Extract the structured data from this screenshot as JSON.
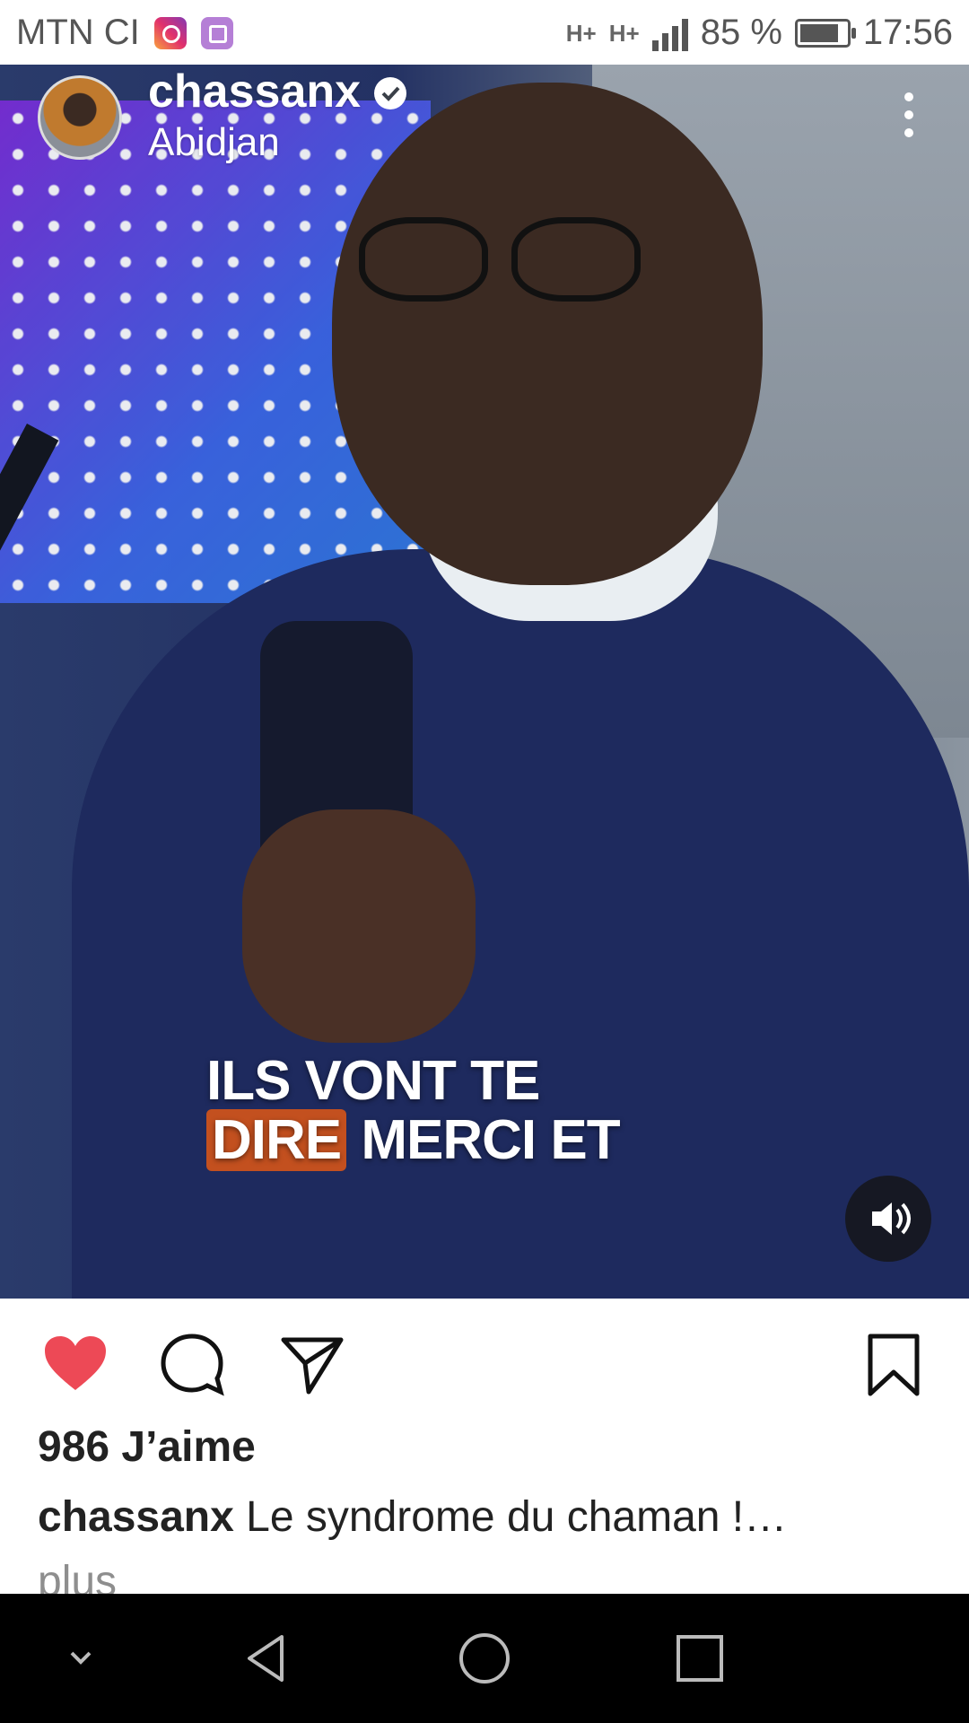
{
  "status_bar": {
    "carrier": "MTN CI",
    "network_1": "H+",
    "network_2": "H+",
    "battery_text": "85 %",
    "battery_level": 0.85,
    "time": "17:56",
    "app_icons": [
      "instagram-icon",
      "gallery-icon"
    ]
  },
  "post": {
    "username": "chassanx",
    "location": "Abidjan",
    "verified": true,
    "video_caption_line1": "ILS VONT TE",
    "video_caption_highlight": "DIRE",
    "video_caption_rest": "MERCI ET",
    "likes": "986 J’aime",
    "caption_user": "chassanx",
    "caption_text": " Le syndrome du chaman !…",
    "more_text": "plus"
  },
  "colors": {
    "like_red": "#ed4956",
    "caption_highlight": "#c3501f"
  },
  "icons": [
    "more-vert-icon",
    "volume-icon",
    "heart-icon",
    "comment-icon",
    "share-icon",
    "bookmark-icon",
    "back-icon",
    "home-icon",
    "recents-icon",
    "chevron-down-icon"
  ]
}
